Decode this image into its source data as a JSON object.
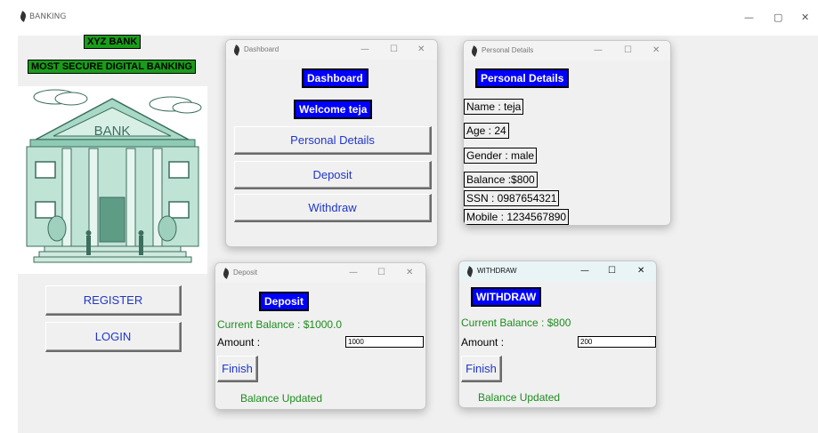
{
  "main_window": {
    "title": "BANKING",
    "controls": {
      "minimize": "—",
      "maximize": "▢",
      "close": "✕"
    }
  },
  "home": {
    "bank_name": "XYZ BANK",
    "tagline": "MOST SECURE DIGITAL BANKING",
    "building_sign": "BANK",
    "register_label": "REGISTER",
    "login_label": "LOGIN"
  },
  "dashboard": {
    "title": "Dashboard",
    "heading": "Dashboard",
    "welcome": "Welcome teja",
    "personal_details_label": "Personal Details",
    "deposit_label": "Deposit",
    "withdraw_label": "Withdraw"
  },
  "personal": {
    "title": "Personal Details",
    "heading": "Personal Details",
    "name": "Name : teja",
    "age": "Age : 24",
    "gender": "Gender : male",
    "balance": "Balance :$800",
    "ssn": "SSN : 0987654321",
    "mobile": "Mobile : 1234567890"
  },
  "deposit": {
    "title": "Deposit",
    "heading": "Deposit",
    "current_balance": "Current Balance : $1000.0",
    "amount_label": "Amount :",
    "amount_value": "1000",
    "finish_label": "Finish",
    "status": "Balance Updated"
  },
  "withdraw": {
    "title": "WITHDRAW",
    "heading": "WITHDRAW",
    "current_balance": "Current Balance : $800",
    "amount_label": "Amount :",
    "amount_value": "200",
    "finish_label": "Finish",
    "status": "Balance Updated"
  },
  "win_controls": {
    "minimize": "—",
    "maximize": "☐",
    "close": "✕"
  },
  "colors": {
    "accent_blue": "#0000ff",
    "bank_green": "#1a9c1a",
    "status_green": "#1e8c1e",
    "button_text": "#1f36c9"
  },
  "icons": [
    "feather-icon",
    "minimize-icon",
    "maximize-icon",
    "close-icon",
    "bank-building-icon"
  ]
}
